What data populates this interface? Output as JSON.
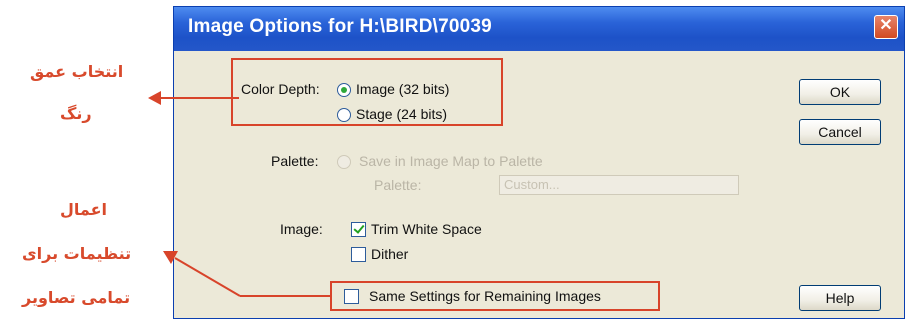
{
  "dialog": {
    "title": "Image Options for H:\\BIRD\\70039",
    "close_glyph": "✕",
    "color_depth": {
      "label": "Color Depth:",
      "options": [
        {
          "label": "Image (32 bits)",
          "selected": true
        },
        {
          "label": "Stage (24 bits)",
          "selected": false
        }
      ]
    },
    "palette": {
      "label": "Palette:",
      "line1": "Save in Image Map to Palette",
      "line2_label": "Palette:",
      "line2_value": "Custom..."
    },
    "image": {
      "label": "Image:",
      "trim_white_space": {
        "label": "Trim White Space",
        "checked": true
      },
      "dither": {
        "label": "Dither",
        "checked": false
      }
    },
    "same_settings": {
      "label": "Same Settings for Remaining Images",
      "checked": false
    },
    "buttons": {
      "ok": "OK",
      "cancel": "Cancel",
      "help": "Help"
    }
  },
  "annotations": {
    "color_depth": [
      "انتخاب عمق",
      "رنگ"
    ],
    "apply_all": [
      "اعمال",
      "تنظیمات برای",
      "تمامی تصاویر"
    ],
    "accent_color": "#d8442a"
  }
}
